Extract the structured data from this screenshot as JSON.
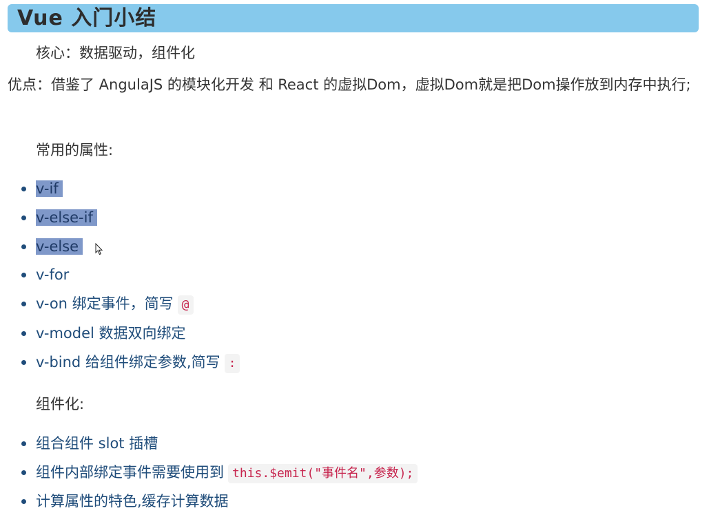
{
  "title": "Vue 入门小结",
  "core": "核心：数据驱动，组件化",
  "advantages": "优点：借鉴了 AngulaJS 的模块化开发 和 React 的虚拟Dom，虚拟Dom就是把Dom操作放到内存中执行;",
  "attrs_heading": "常用的属性:",
  "attrs": [
    {
      "text": "v-if",
      "highlighted": true
    },
    {
      "text": "v-else-if",
      "highlighted": true
    },
    {
      "text": "v-else",
      "highlighted": true
    },
    {
      "text": "v-for"
    },
    {
      "text": "v-on 绑定事件，简写",
      "code": "@"
    },
    {
      "text": "v-model 数据双向绑定"
    },
    {
      "text": "v-bind 给组件绑定参数,简写",
      "code": ":"
    }
  ],
  "comp_heading": "组件化:",
  "comp": [
    {
      "text": "组合组件 slot 插槽"
    },
    {
      "text": "组件内部绑定事件需要使用到",
      "code": "this.$emit(\"事件名\",参数);"
    },
    {
      "text": "计算属性的特色,缓存计算数据"
    }
  ],
  "colors": {
    "title_bg": "#86c9ec",
    "list_text": "#1f4c7a",
    "highlight": "#7f98c9",
    "code": "#c7254e"
  }
}
